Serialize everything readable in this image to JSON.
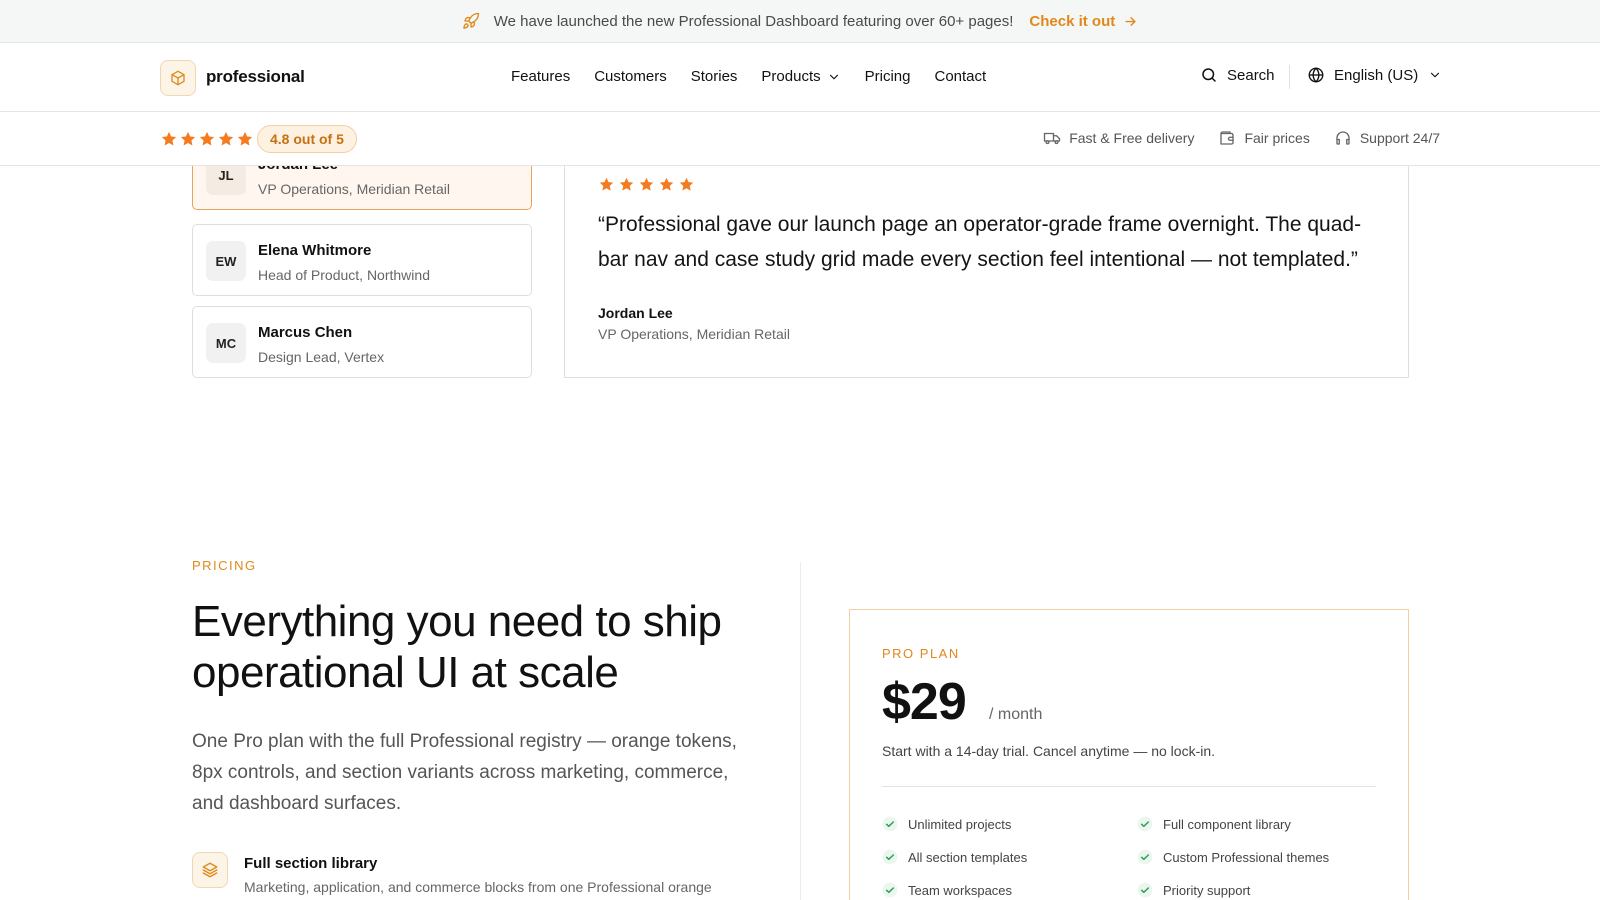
{
  "colors": {
    "accent": "#e0891b",
    "star": "#f47b20",
    "check": "#2e9e5a",
    "border": "#dedede"
  },
  "announcement": {
    "icon": "rocket-icon",
    "text": "We have launched the new Professional Dashboard featuring over 60+ pages!",
    "cta_label": "Check it out"
  },
  "nav": {
    "brand": "professional",
    "links": [
      "Features",
      "Customers",
      "Stories",
      "Products",
      "Pricing",
      "Contact"
    ],
    "search_label": "Search",
    "language_label": "English (US)"
  },
  "rating": {
    "stars": 5,
    "label": "4.8 out of 5",
    "perks": [
      "Fast & Free delivery",
      "Fair prices",
      "Support 24/7"
    ]
  },
  "testimonials": {
    "people": [
      {
        "initials": "JL",
        "name": "Jordan Lee",
        "role": "VP Operations, Meridian Retail"
      },
      {
        "initials": "EW",
        "name": "Elena Whitmore",
        "role": "Head of Product, Northwind"
      },
      {
        "initials": "MC",
        "name": "Marcus Chen",
        "role": "Design Lead, Vertex"
      }
    ],
    "active_index": 0,
    "quote": {
      "stars": 5,
      "text": "“Professional gave our launch page an operator-grade frame overnight. The quad-bar nav and case study grid made every section feel intentional — not templated.”",
      "name": "Jordan Lee",
      "role": "VP Operations, Meridian Retail"
    }
  },
  "pricing": {
    "eyebrow": "PRICING",
    "title": "Everything you need to ship operational UI at scale",
    "description": "One Pro plan with the full Professional registry — orange tokens, 8px controls, and section variants across marketing, commerce, and dashboard surfaces.",
    "feature": {
      "title": "Full section library",
      "description": "Marketing, application, and commerce blocks from one Professional orange"
    },
    "plan": {
      "eyebrow": "PRO PLAN",
      "price": "$29",
      "period": "/ month",
      "trial": "Start with a 14-day trial. Cancel anytime — no lock-in.",
      "features": [
        "Unlimited projects",
        "Full component library",
        "All section templates",
        "Custom Professional themes",
        "Team workspaces",
        "Priority support"
      ]
    }
  }
}
